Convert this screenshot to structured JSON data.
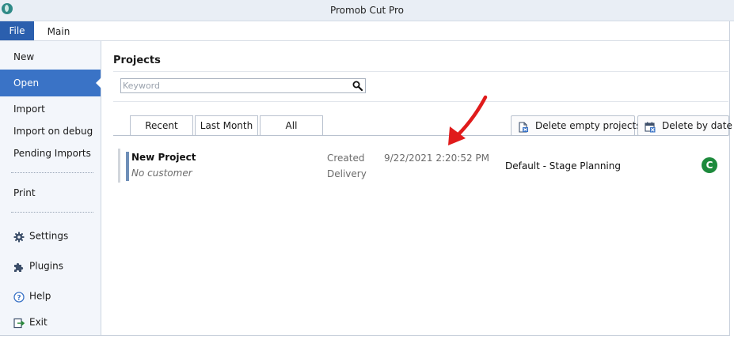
{
  "window": {
    "title": "Promob Cut Pro"
  },
  "ribbon": {
    "file_label": "File",
    "main_label": "Main"
  },
  "sidebar": {
    "items": [
      {
        "label": "New"
      },
      {
        "label": "Open"
      },
      {
        "label": "Import"
      },
      {
        "label": "Import on debug"
      },
      {
        "label": "Pending Imports"
      },
      {
        "label": "Print"
      },
      {
        "label": "Settings",
        "icon": "gear-icon"
      },
      {
        "label": "Plugins",
        "icon": "puzzle-icon"
      },
      {
        "label": "Help",
        "icon": "help-icon"
      },
      {
        "label": "Exit",
        "icon": "exit-icon"
      }
    ],
    "active": "Open"
  },
  "projects": {
    "heading": "Projects",
    "search": {
      "placeholder": "Keyword",
      "value": ""
    },
    "tabs": [
      {
        "label": "Recent"
      },
      {
        "label": "Last Month"
      },
      {
        "label": "All"
      }
    ],
    "active_tab": "Recent",
    "buttons": {
      "delete_empty": "Delete empty projects",
      "delete_by_date": "Delete by date"
    },
    "rows": [
      {
        "name": "New Project",
        "customer": "No customer",
        "created_label": "Created",
        "delivery_label": "Delivery",
        "created_date": "9/22/2021 2:20:52 PM",
        "stage": "Default - Stage Planning",
        "status_letter": "C"
      }
    ]
  },
  "colors": {
    "accent": "#3a73c6",
    "file_tab": "#2b5fae",
    "status_green": "#1d8a3c",
    "annotation_arrow": "#e01b1b"
  }
}
